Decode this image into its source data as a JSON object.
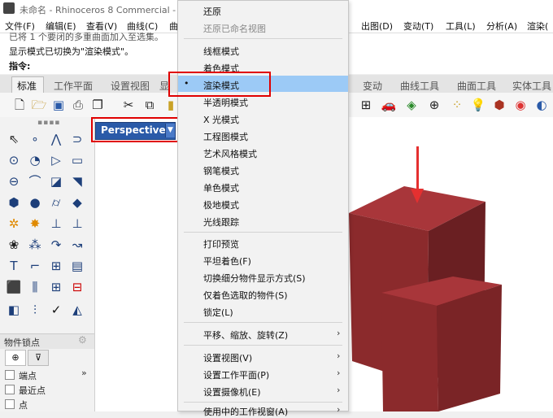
{
  "titlebar": {
    "title": "未命名 - Rhinoceros 8 Commercial -"
  },
  "menubar": {
    "items_left": [
      "文件(F)",
      "编辑(E)",
      "查看(V)",
      "曲线(C)",
      "曲"
    ],
    "items_right": [
      "出图(D)",
      "变动(T)",
      "工具(L)",
      "分析(A)",
      "渲染("
    ]
  },
  "command": {
    "line1": "已将 1 个要闭的多重曲面加入至选集。",
    "line2": "显示模式已切换为\"渲染模式\"。",
    "prompt": "指令:"
  },
  "tabs": {
    "left": [
      "标准",
      "工作平面",
      "设置视图",
      "显"
    ],
    "right": [
      "变动",
      "曲线工具",
      "曲面工具",
      "实体工具"
    ]
  },
  "toolbar": {
    "icons": [
      "new-file",
      "open-folder",
      "save",
      "print",
      "import",
      "cut",
      "copy",
      "paste",
      "grid",
      "car",
      "texture-map",
      "target",
      "select-points",
      "light-bulb",
      "render-material",
      "color-wheel"
    ]
  },
  "viewport": {
    "label": "Perspective",
    "dropdown_glyph": "▼"
  },
  "snap_panel": {
    "title": "物件锁点",
    "options": [
      "端点",
      "最近点",
      "点"
    ],
    "expand": "»"
  },
  "dropdown": {
    "items": [
      {
        "label": "还原",
        "disabled": false,
        "submenu": false
      },
      {
        "label": "还原已命名视图",
        "disabled": true,
        "submenu": false
      },
      {
        "label": "线框模式",
        "disabled": false,
        "submenu": false
      },
      {
        "label": "着色模式",
        "disabled": false,
        "submenu": false
      },
      {
        "label": "渲染模式",
        "disabled": false,
        "submenu": false,
        "selected": true
      },
      {
        "label": "半透明模式",
        "disabled": false,
        "submenu": false
      },
      {
        "label": "X 光模式",
        "disabled": false,
        "submenu": false
      },
      {
        "label": "工程图模式",
        "disabled": false,
        "submenu": false
      },
      {
        "label": "艺术风格模式",
        "disabled": false,
        "submenu": false
      },
      {
        "label": "钢笔模式",
        "disabled": false,
        "submenu": false
      },
      {
        "label": "单色模式",
        "disabled": false,
        "submenu": false
      },
      {
        "label": "极地模式",
        "disabled": false,
        "submenu": false
      },
      {
        "label": "光线跟踪",
        "disabled": false,
        "submenu": false
      },
      {
        "label": "打印预览",
        "disabled": false,
        "submenu": false
      },
      {
        "label": "平坦着色(F)",
        "disabled": false,
        "submenu": false
      },
      {
        "label": "切换细分物件显示方式(S)",
        "disabled": false,
        "submenu": false
      },
      {
        "label": "仅着色选取的物件(S)",
        "disabled": false,
        "submenu": false
      },
      {
        "label": "锁定(L)",
        "disabled": false,
        "submenu": false
      },
      {
        "label": "平移、缩放、旋转(Z)",
        "disabled": false,
        "submenu": true
      },
      {
        "label": "设置视图(V)",
        "disabled": false,
        "submenu": true
      },
      {
        "label": "设置工作平面(P)",
        "disabled": false,
        "submenu": true
      },
      {
        "label": "设置摄像机(E)",
        "disabled": false,
        "submenu": true
      },
      {
        "label": "使用中的工作视窗(A)",
        "disabled": false,
        "submenu": true
      }
    ],
    "bullet": "•",
    "submenu_arrow": "›"
  },
  "colors": {
    "cube_front": "#8b2a2c",
    "cube_top": "#a8363a",
    "cube_side": "#6a1f22",
    "highlight": "#e00000",
    "hover": "#9ccaf6",
    "viewport_tab": "#2a5aa8"
  }
}
